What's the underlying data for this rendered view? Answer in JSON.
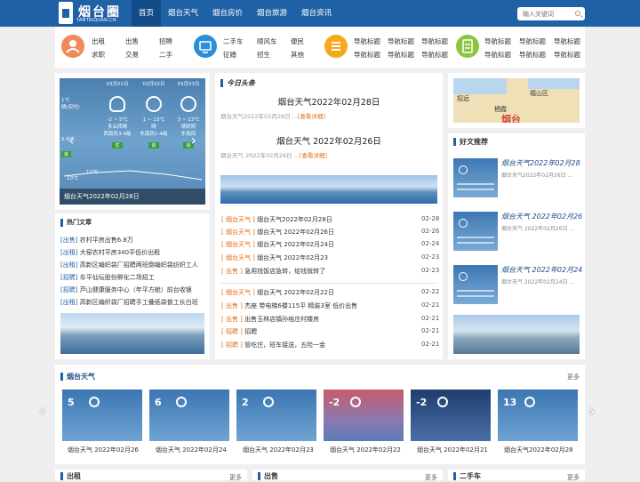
{
  "header": {
    "logo_text": "烟台圈",
    "logo_sub": "YANTAIQUAN.CN",
    "nav": [
      "首页",
      "烟台天气",
      "烟台房价",
      "烟台旅游",
      "烟台资讯"
    ],
    "search_placeholder": "输入关键词"
  },
  "categories": {
    "group1": {
      "c1": [
        "出租",
        "求职"
      ],
      "c2": [
        "出售",
        "交易"
      ],
      "c3": [
        "招聘",
        "二手"
      ]
    },
    "group2": {
      "c1": [
        "二手车",
        "征婚"
      ],
      "c2": [
        "顺风车",
        "招生"
      ],
      "c3": [
        "便民",
        "其他"
      ]
    },
    "group3": {
      "c1": [
        "导航标题",
        "导航标题"
      ],
      "c2": [
        "导航标题",
        "导航标题"
      ],
      "c3": [
        "导航标题",
        "导航标题"
      ]
    },
    "group4": {
      "c1": [
        "导航标题",
        "导航标题"
      ],
      "c2": [
        "导航标题",
        "导航标题"
      ],
      "c3": [
        "导航标题",
        "导航标题"
      ]
    }
  },
  "slider": {
    "caption": "烟台天气2022年02月28日",
    "days": [
      {
        "date": "03月01日",
        "temp": "-2 ~ 5℃",
        "desc": "多云转晴",
        "wind": "西南风3-4级",
        "aqi": "优"
      },
      {
        "date": "03月02日",
        "temp": "1 ~ 13℃",
        "desc": "晴",
        "wind": "东南风1-4级",
        "aqi": "良"
      },
      {
        "date": "03月03日",
        "temp": "3 ~ 13℃",
        "desc": "晴转阴",
        "wind": "东南风",
        "aqi": "良"
      }
    ],
    "left_temp": "1℃",
    "left_desc": "晴(实时)",
    "left_range": "5-6℃",
    "left_aqi": "良",
    "chart_nums": [
      "12℃",
      "10℃"
    ]
  },
  "hot": {
    "title": "热门文章",
    "items": [
      {
        "tag": "[出售]",
        "text": "农村平房出售6.8万"
      },
      {
        "tag": "[出租]",
        "text": "大窑农村平房340平低价出租"
      },
      {
        "tag": "[出租]",
        "text": "高新区编织袋厂招聘两班倒编织袋纺织工人"
      },
      {
        "tag": "[招聘]",
        "text": "牟平仙坛股份孵化二场招工"
      },
      {
        "tag": "[招聘]",
        "text": "芦山健康服务中心（年平方舱）前台收银"
      },
      {
        "tag": "[出租]",
        "text": "高新区编织袋厂招聘手工叠纸袋普工长白班"
      }
    ]
  },
  "headline": {
    "title": "今日头条",
    "h1": "烟台天气2022年02月28日",
    "h1_summary": "烟台天气2022年02月28日 ...",
    "h2": "烟台天气 2022年02月26日",
    "h2_summary": "烟台天气 2022年02月26日 ...",
    "more": "[查看详细]"
  },
  "news": [
    {
      "tag": "[ 烟台天气 ]",
      "text": "烟台天气2022年02月28日",
      "date": "02-28"
    },
    {
      "tag": "[ 烟台天气 ]",
      "text": "烟台天气 2022年02月26日",
      "date": "02-26"
    },
    {
      "tag": "[ 烟台天气 ]",
      "text": "烟台天气 2022年02月24日",
      "date": "02-24"
    },
    {
      "tag": "[ 烟台天气 ]",
      "text": "烟台天气 2022年02月23",
      "date": "02-23"
    },
    {
      "tag": "[ 出售 ]",
      "text": "急用钱饭店急转，给钱就转了",
      "date": "02-23"
    },
    {
      "tag": "[ 烟台天气 ]",
      "text": "烟台天气 2022年02月22日",
      "date": "02-22"
    },
    {
      "tag": "[ 出售 ]",
      "text": "杰座 带电梯6楼115平 精装3室 低价出售",
      "date": "02-21"
    },
    {
      "tag": "[ 出售 ]",
      "text": "出售玉林店镇孙格庄村楼房",
      "date": "02-21"
    },
    {
      "tag": "[ 招聘 ]",
      "text": "招聘",
      "date": "02-21"
    },
    {
      "tag": "[ 招聘 ]",
      "text": "管吃住，班车接送，五险一金",
      "date": "02-21"
    }
  ],
  "map": {
    "labels": [
      "招远",
      "栖霞",
      "福山区",
      "烟台"
    ]
  },
  "recommend": {
    "title": "好文推荐",
    "items": [
      {
        "title": "烟台天气2022年02月28",
        "sub": "烟台天气2022年02月26日 ..."
      },
      {
        "title": "烟台天气 2022年02月26",
        "sub": "烟台天气 2022年02月26日 ..."
      },
      {
        "title": "烟台天气 2022年02月24",
        "sub": "烟台天气 2022年02月24日 ..."
      }
    ]
  },
  "weather": {
    "title": "烟台天气",
    "more": "更多",
    "cards": [
      {
        "temp": "5",
        "caption": "烟台天气 2022年02月26"
      },
      {
        "temp": "6",
        "caption": "烟台天气 2022年02月24"
      },
      {
        "temp": "2",
        "caption": "烟台天气 2022年02月23"
      },
      {
        "temp": "-2",
        "caption": "烟台天气 2022年02月22"
      },
      {
        "temp": "-2",
        "caption": "烟台天气 2022年02月21"
      },
      {
        "temp": "13",
        "caption": "烟台天气2022年02月28"
      }
    ]
  },
  "bottom": {
    "b1": "出租",
    "b2": "出售",
    "b3": "二手车",
    "more": "更多"
  }
}
